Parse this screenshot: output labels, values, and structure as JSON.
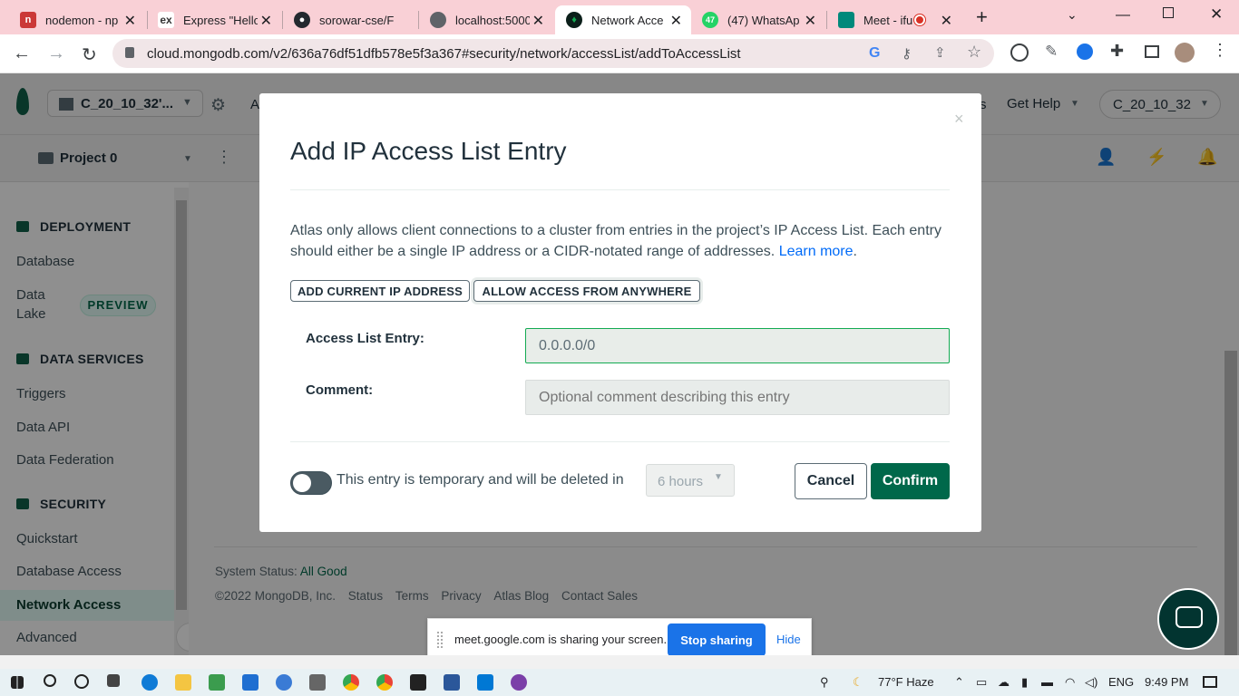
{
  "browser": {
    "tabs": [
      {
        "title": "nodemon - np",
        "icon": "npm-icon",
        "color": "#cb3837"
      },
      {
        "title": "Express \"Hello",
        "icon": "express-icon",
        "color": "#333333"
      },
      {
        "title": "sorowar-cse/F",
        "icon": "github-icon",
        "color": "#24292f"
      },
      {
        "title": "localhost:5000",
        "icon": "globe-icon",
        "color": "#5f6368"
      },
      {
        "title": "Network Acce",
        "icon": "mongodb-leaf-icon",
        "color": "#13aa52"
      },
      {
        "title": "(47) WhatsAp",
        "icon": "whatsapp-icon",
        "color": "#25d366",
        "badge": "47"
      },
      {
        "title": "Meet - ifu",
        "icon": "google-meet-icon",
        "color": "#00897b"
      }
    ],
    "url": "cloud.mongodb.com/v2/636a76df51dfb578e5f3a367#security/network/accessList/addToAccessList"
  },
  "header": {
    "org": "C_20_10_32'...",
    "get_help": "Get Help",
    "user": "C_20_10_32",
    "partial_tab": "A",
    "partial_right": "s"
  },
  "project": {
    "name": "Project 0"
  },
  "sidebar": {
    "deployment": "DEPLOYMENT",
    "database": "Database",
    "data_lake_1": "Data",
    "data_lake_2": "Lake",
    "preview": "PREVIEW",
    "data_services": "DATA SERVICES",
    "triggers": "Triggers",
    "data_api": "Data API",
    "data_federation": "Data Federation",
    "security": "SECURITY",
    "quickstart": "Quickstart",
    "database_access": "Database Access",
    "network_access": "Network Access",
    "advanced": "Advanced"
  },
  "footer": {
    "system_status": "System Status:",
    "all_good": "All Good",
    "copyright": "©2022 MongoDB, Inc.",
    "links": [
      "Status",
      "Terms",
      "Privacy",
      "Atlas Blog",
      "Contact Sales"
    ]
  },
  "modal": {
    "title": "Add IP Access List Entry",
    "description": "Atlas only allows client connections to a cluster from entries in the project’s IP Access List. Each entry should either be a single IP address or a CIDR-notated range of addresses.",
    "learn_more": "Learn more",
    "add_current_ip": "ADD CURRENT IP ADDRESS",
    "allow_anywhere": "ALLOW ACCESS FROM ANYWHERE",
    "entry_label": "Access List Entry:",
    "entry_value": "0.0.0.0/0",
    "comment_label": "Comment:",
    "comment_placeholder": "Optional comment describing this entry",
    "temporary_text": "This entry is temporary and will be deleted in",
    "duration": "6 hours",
    "cancel": "Cancel",
    "confirm": "Confirm",
    "temporary_enabled": false
  },
  "share_banner": {
    "text": "meet.google.com is sharing your screen.",
    "stop": "Stop sharing",
    "hide": "Hide"
  },
  "taskbar": {
    "weather": "77°F  Haze",
    "lang": "ENG",
    "time": "9:49 PM"
  },
  "colors": {
    "accent_green": "#00684a",
    "link_blue": "#016bf8",
    "tab_bar": "#f9d0d6",
    "chrome_blue": "#1a73e8"
  }
}
